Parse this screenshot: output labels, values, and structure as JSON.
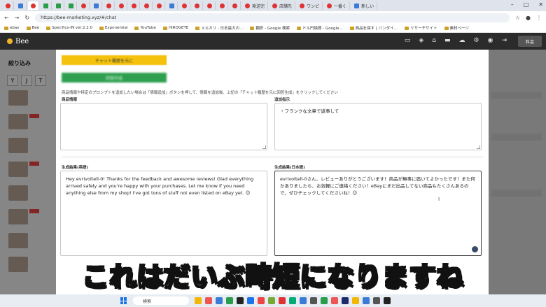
{
  "browser": {
    "tabs": [
      {
        "label": "",
        "fav": "r"
      },
      {
        "label": "",
        "fav": "b"
      },
      {
        "label": "",
        "fav": "r"
      },
      {
        "label": "",
        "fav": "g"
      },
      {
        "label": "",
        "fav": "g"
      },
      {
        "label": "",
        "fav": "g"
      },
      {
        "label": "",
        "fav": "r"
      },
      {
        "label": "",
        "fav": "b"
      },
      {
        "label": "",
        "fav": "r"
      },
      {
        "label": "",
        "fav": "r"
      },
      {
        "label": "",
        "fav": "r"
      },
      {
        "label": "",
        "fav": "r"
      },
      {
        "label": "",
        "fav": "r"
      },
      {
        "label": "",
        "fav": "b"
      },
      {
        "label": "",
        "fav": "r"
      },
      {
        "label": "",
        "fav": "r"
      },
      {
        "label": "",
        "fav": "r"
      },
      {
        "label": "",
        "fav": "r"
      },
      {
        "label": "",
        "fav": "r"
      },
      {
        "label": "発送完",
        "fav": "r"
      },
      {
        "label": "店舗先",
        "fav": "r"
      },
      {
        "label": "ワンピ",
        "fav": "r"
      },
      {
        "label": "一番く",
        "fav": "r"
      },
      {
        "label": "新しい",
        "fav": "b"
      }
    ],
    "url": "https://bee-marketing.xyz/#/chat",
    "bookmarks": [
      "ebay",
      "Bee",
      "Specifics-IN ver.2.2.0",
      "Exponential",
      "YouTube",
      "HIROGETE",
      "メルカリ - 日本最大の...",
      "翻訳 - Google 検索",
      "ドル円換算 - Google...",
      "商品を探す | バンダイ...",
      "リサーチサイト",
      "素材ページ"
    ],
    "window_controls": [
      "–",
      "□",
      "✕"
    ]
  },
  "app": {
    "logo": "Bee",
    "price_button": "料金"
  },
  "sidebar": {
    "title": "絞り込み",
    "filter_keys": [
      "Y",
      "J",
      "T"
    ]
  },
  "modal": {
    "btn_history": "チャット履歴を元に",
    "btn_generate": "回答作成",
    "hint": "商品情報や特定のプロンプトを追加したい場合は「情報追加」ボタンを押して、情報を追加後、上記の「チャット履歴を元に回答生成」をクリックしてください",
    "product_label": "商品情報",
    "product_value": "",
    "prompt_label": "追加指示",
    "prompt_value": "・フランクな文章で返事して",
    "result_en_label": "生成結果(英語)",
    "result_en": "Hey evrivoltell-0! Thanks for the feedback and awesome reviews!  Glad everything arrived safely and you're happy with your purchases.  Let me know if you need anything else from my shop! I've got tons of stuff not even listed on eBay yet. 😉",
    "result_ja_label": "生成結果(日本語)",
    "result_ja": "evrivoltell-0さん、レビューありがとうございます！商品が無事に届いてよかったです！また何かありましたら、お気軽にご連絡ください！eBayにまだ出品してない商品もたくさんあるので、ぜひチェックしてくださいね！😉"
  },
  "caption": "これはだいぶ時短になりますね",
  "taskbar": {
    "search_placeholder": "検索",
    "time": "",
    "date": ""
  }
}
